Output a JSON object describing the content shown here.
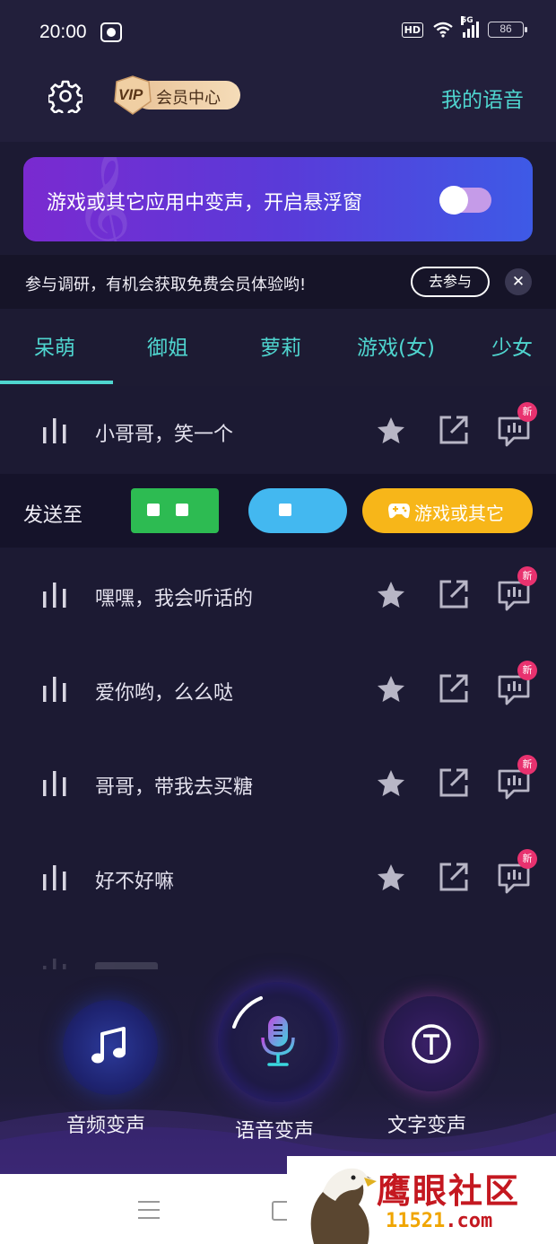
{
  "status_bar": {
    "time": "20:00",
    "battery": "86",
    "hd": "HD",
    "net": "5G"
  },
  "header": {
    "vip_label": "VIP",
    "member_center": "会员中心",
    "my_voice": "我的语音"
  },
  "banner": {
    "text": "游戏或其它应用中变声，开启悬浮窗",
    "toggle_on": false
  },
  "survey": {
    "text": "参与调研，有机会获取免费会员体验哟!",
    "join_button": "去参与"
  },
  "tabs": [
    {
      "label": "呆萌",
      "active": true
    },
    {
      "label": "御姐",
      "active": false
    },
    {
      "label": "萝莉",
      "active": false
    },
    {
      "label": "游戏(女)",
      "active": false
    },
    {
      "label": "少女",
      "active": false
    }
  ],
  "voices": [
    {
      "title": "小哥哥，笑一个",
      "badge": "新"
    },
    {
      "title": "嘿嘿，我会听话的",
      "badge": "新"
    },
    {
      "title": "爱你哟，么么哒",
      "badge": "新"
    },
    {
      "title": "哥哥，带我去买糖",
      "badge": "新"
    },
    {
      "title": "好不好嘛",
      "badge": "新"
    }
  ],
  "send_bar": {
    "label": "发送至",
    "game_button": "游戏或其它"
  },
  "dock": {
    "audio_label": "音频变声",
    "voice_label": "语音变声",
    "text_label": "文字变声"
  },
  "watermark": {
    "title": "鹰眼社区",
    "url_part1": "11521",
    "url_part2": ".com"
  },
  "colors": {
    "accent": "#4fd5cf",
    "background": "#1c1a33",
    "new_badge": "#e8326f",
    "game_button": "#f7b619"
  }
}
